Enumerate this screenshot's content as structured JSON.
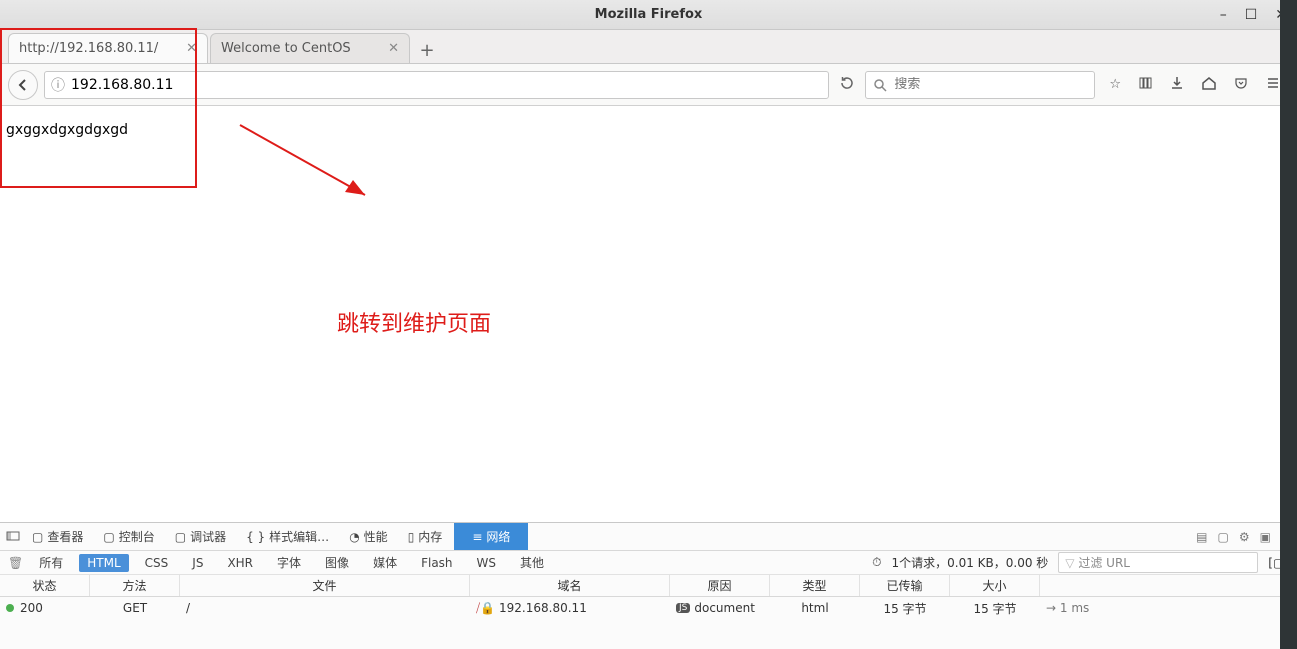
{
  "window": {
    "title": "Mozilla Firefox"
  },
  "tabs": [
    {
      "label": "http://192.168.80.11/",
      "active": true
    },
    {
      "label": "Welcome to CentOS",
      "active": false
    }
  ],
  "url": "192.168.80.11",
  "search_placeholder": "搜索",
  "page_body": "gxggxdgxgdgxgd",
  "annotation": "跳转到维护页面",
  "devtools": {
    "tabs": {
      "inspector": "查看器",
      "console": "控制台",
      "debugger": "调试器",
      "style": "样式编辑…",
      "perf": "性能",
      "memory": "内存",
      "network": "网络"
    },
    "filters": {
      "all": "所有",
      "html": "HTML",
      "css": "CSS",
      "js": "JS",
      "xhr": "XHR",
      "font": "字体",
      "img": "图像",
      "media": "媒体",
      "flash": "Flash",
      "ws": "WS",
      "other": "其他"
    },
    "summary": "1个请求，0.01 KB，0.00 秒",
    "filter_url_placeholder": "过滤 URL",
    "columns": {
      "status": "状态",
      "method": "方法",
      "file": "文件",
      "domain": "域名",
      "cause": "原因",
      "type": "类型",
      "transferred": "已传输",
      "size": "大小"
    },
    "rows": [
      {
        "status": "200",
        "method": "GET",
        "file": "/",
        "domain": "192.168.80.11",
        "cause": "document",
        "type": "html",
        "transferred": "15 字节",
        "size": "15 字节",
        "time": "→ 1 ms"
      }
    ]
  }
}
